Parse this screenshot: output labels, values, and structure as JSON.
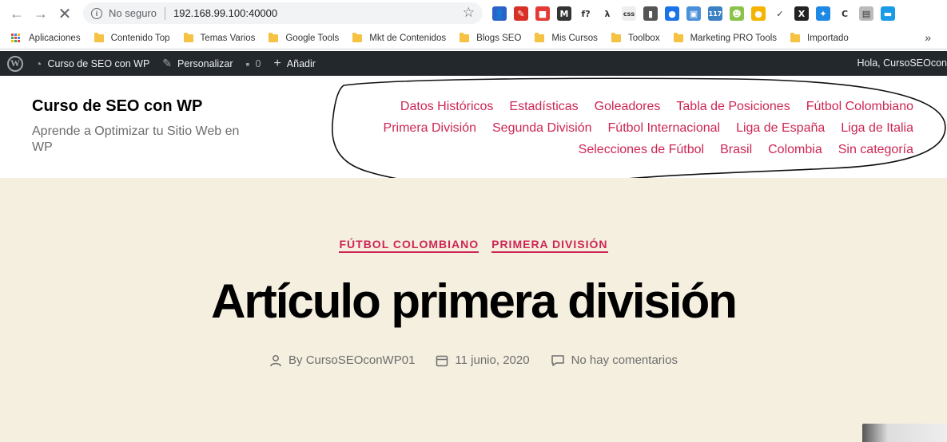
{
  "browser": {
    "security_label": "No seguro",
    "url": "192.168.99.100:40000",
    "extensions": [
      {
        "name": "person-ext",
        "glyph": "👤",
        "color": "#2a62c8"
      },
      {
        "name": "pen-ext",
        "glyph": "✎",
        "color": "#d93025"
      },
      {
        "name": "red-ext",
        "glyph": "■",
        "color": "#e53935"
      },
      {
        "name": "m-ext",
        "glyph": "M",
        "color": "#333333"
      },
      {
        "name": "fx-ext",
        "glyph": "f?",
        "color": "#ffffff"
      },
      {
        "name": "lambda-ext",
        "glyph": "λ",
        "color": "#ffffff"
      },
      {
        "name": "css-ext",
        "glyph": "css",
        "color": "#eeeeee"
      },
      {
        "name": "barcode-ext",
        "glyph": "▮",
        "color": "#555555"
      },
      {
        "name": "blue-ext",
        "glyph": "●",
        "color": "#1a73e8"
      },
      {
        "name": "tab-ext",
        "glyph": "▣",
        "color": "#4a90d9"
      },
      {
        "name": "badge-ext",
        "glyph": "117",
        "color": "#3b82c4"
      },
      {
        "name": "android-ext",
        "glyph": "☻",
        "color": "#8bc34a"
      },
      {
        "name": "dots-ext",
        "glyph": "●",
        "color": "#f4b400"
      },
      {
        "name": "brush-ext",
        "glyph": "✓",
        "color": "#ffffff"
      },
      {
        "name": "x-ext",
        "glyph": "X",
        "color": "#222222"
      },
      {
        "name": "feather-ext",
        "glyph": "✦",
        "color": "#1e88e5"
      },
      {
        "name": "c-ext",
        "glyph": "C",
        "color": "#ffffff"
      },
      {
        "name": "clip-ext",
        "glyph": "▤",
        "color": "#bbbbbb"
      },
      {
        "name": "window-ext",
        "glyph": "▬",
        "color": "#1a9be8"
      }
    ]
  },
  "bookmarks": {
    "apps_label": "Aplicaciones",
    "folders": [
      "Contenido Top",
      "Temas Varios",
      "Google Tools",
      "Mkt de Contenidos",
      "Blogs SEO",
      "Mis Cursos",
      "Toolbox",
      "Marketing PRO Tools",
      "Importado"
    ],
    "more": "»"
  },
  "adminbar": {
    "site_name": "Curso de SEO con WP",
    "customize": "Personalizar",
    "comments_count": "0",
    "add_new": "Añadir",
    "greeting": "Hola, CursoSEOcon"
  },
  "site": {
    "title": "Curso de SEO con WP",
    "description": "Aprende a Optimizar tu Sitio Web en WP",
    "menu": [
      "Datos Históricos",
      "Estadísticas",
      "Goleadores",
      "Tabla de Posiciones",
      "Fútbol Colombiano",
      "Primera División",
      "Segunda División",
      "Fútbol Internacional",
      "Liga de España",
      "Liga de Italia",
      "Selecciones de Fútbol",
      "Brasil",
      "Colombia",
      "Sin categoría"
    ]
  },
  "post": {
    "categories": [
      "FÚTBOL COLOMBIANO",
      "PRIMERA DIVISIÓN"
    ],
    "title": "Artículo primera división",
    "author": "By CursoSEOconWP01",
    "date": "11 junio, 2020",
    "comments": "No hay comentarios"
  },
  "colors": {
    "accent": "#cd2653",
    "admin_bar": "#23282d",
    "content_bg": "#f5efe0"
  }
}
